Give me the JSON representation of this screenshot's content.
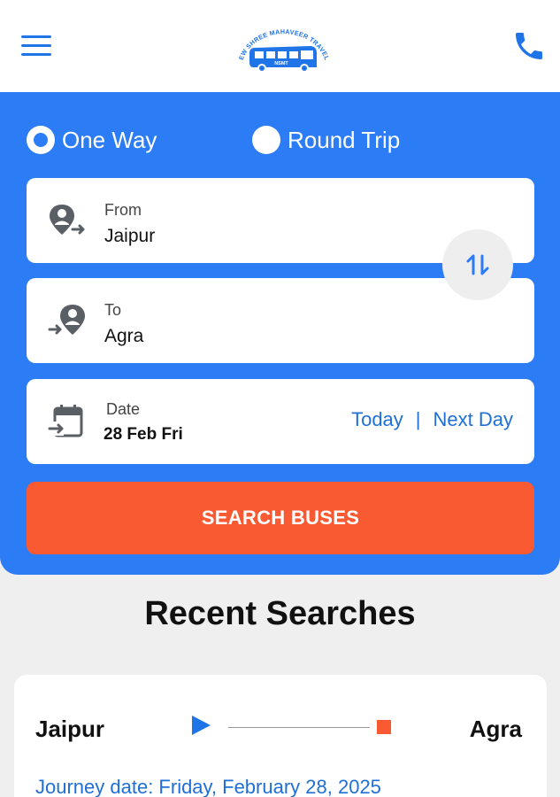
{
  "header": {
    "logo_text": "NEW SHREE MAHAVEER TRAVELS",
    "logo_badge": "NSMT",
    "menu_icon": "hamburger-menu-icon",
    "phone_icon": "phone-icon"
  },
  "trip_type": {
    "options": [
      {
        "label": "One Way",
        "selected": true
      },
      {
        "label": "Round Trip",
        "selected": false
      }
    ]
  },
  "search": {
    "from": {
      "caption": "From",
      "value": "Jaipur",
      "icon": "departure-location-icon"
    },
    "to": {
      "caption": "To",
      "value": "Agra",
      "icon": "arrival-location-icon"
    },
    "date": {
      "caption": "Date",
      "value": "28 Feb Fri",
      "icon": "calendar-icon",
      "today_label": "Today",
      "separator": "|",
      "next_day_label": "Next Day"
    },
    "swap_icon": "swap-vertical-icon",
    "button_label": "SEARCH BUSES"
  },
  "recent": {
    "title": "Recent Searches",
    "items": [
      {
        "from": "Jaipur",
        "to": "Agra",
        "journey_date": "Journey date: Friday, February 28, 2025"
      }
    ]
  },
  "colors": {
    "primary_blue": "#2c7cf6",
    "accent_orange": "#fa5a32",
    "link_blue": "#1f6fd6",
    "background": "#efefef"
  }
}
